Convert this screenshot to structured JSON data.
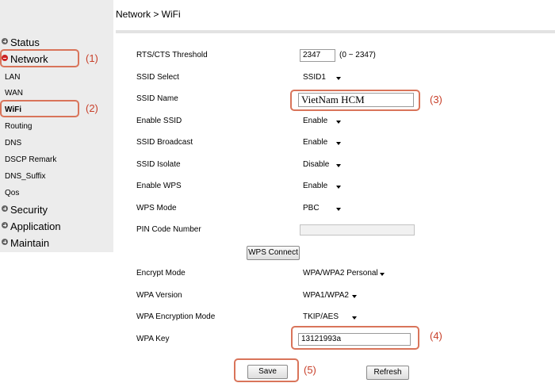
{
  "breadcrumb": "Network > WiFi",
  "sidebar": {
    "groups": [
      {
        "label": "Status"
      },
      {
        "label": "Network"
      },
      {
        "label": "Security"
      },
      {
        "label": "Application"
      },
      {
        "label": "Maintain"
      }
    ],
    "items": [
      "LAN",
      "WAN",
      "WiFi",
      "Routing",
      "DNS",
      "DSCP Remark",
      "DNS_Suffix",
      "Qos"
    ]
  },
  "steps": [
    "(1)",
    "(2)",
    "(3)",
    "(4)",
    "(5)"
  ],
  "form": {
    "rts": {
      "label": "RTS/CTS Threshold",
      "value": "2347",
      "hint": "(0 ~ 2347)"
    },
    "ssid_select": {
      "label": "SSID Select",
      "value": "SSID1"
    },
    "ssid_name": {
      "label": "SSID Name",
      "value": "VietNam HCM"
    },
    "enable_ssid": {
      "label": "Enable SSID",
      "value": "Enable"
    },
    "ssid_broadcast": {
      "label": "SSID Broadcast",
      "value": "Enable"
    },
    "ssid_isolate": {
      "label": "SSID Isolate",
      "value": "Disable"
    },
    "enable_wps": {
      "label": "Enable WPS",
      "value": "Enable"
    },
    "wps_mode": {
      "label": "WPS Mode",
      "value": "PBC"
    },
    "pin_code": {
      "label": "PIN Code Number",
      "value": ""
    },
    "wps_connect": "WPS Connect",
    "encrypt_mode": {
      "label": "Encrypt Mode",
      "value": "WPA/WPA2 Personal"
    },
    "wpa_version": {
      "label": "WPA Version",
      "value": "WPA1/WPA2"
    },
    "wpa_encryption": {
      "label": "WPA Encryption Mode",
      "value": "TKIP/AES"
    },
    "wpa_key": {
      "label": "WPA Key",
      "value": "13121993a"
    }
  },
  "buttons": {
    "save": "Save",
    "refresh": "Refresh"
  },
  "colors": {
    "highlight": "#d9745a",
    "step": "#c8402a",
    "sidebar": "#ececec"
  }
}
